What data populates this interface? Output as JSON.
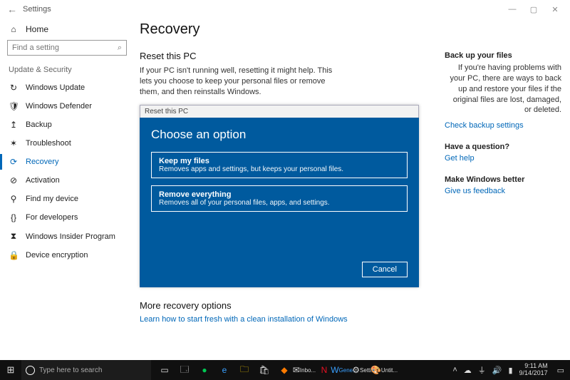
{
  "titlebar": {
    "title": "Settings"
  },
  "sidebar": {
    "home": "Home",
    "search_placeholder": "Find a setting",
    "group": "Update & Security",
    "items": [
      {
        "label": "Windows Update",
        "icon": "↻"
      },
      {
        "label": "Windows Defender",
        "icon": "🛡"
      },
      {
        "label": "Backup",
        "icon": "↥"
      },
      {
        "label": "Troubleshoot",
        "icon": "✶"
      },
      {
        "label": "Recovery",
        "icon": "⟳",
        "active": true
      },
      {
        "label": "Activation",
        "icon": "⊘"
      },
      {
        "label": "Find my device",
        "icon": "⚲"
      },
      {
        "label": "For developers",
        "icon": "{}"
      },
      {
        "label": "Windows Insider Program",
        "icon": "⧗"
      },
      {
        "label": "Device encryption",
        "icon": "🔒"
      }
    ]
  },
  "content": {
    "heading": "Recovery",
    "reset_heading": "Reset this PC",
    "reset_desc": "If your PC isn't running well, resetting it might help. This lets you choose to keep your personal files or remove them, and then reinstalls Windows.",
    "more_heading": "More recovery options",
    "more_link": "Learn how to start fresh with a clean installation of Windows"
  },
  "dialog": {
    "header": "Reset this PC",
    "title": "Choose an option",
    "options": [
      {
        "title": "Keep my files",
        "sub": "Removes apps and settings, but keeps your personal files."
      },
      {
        "title": "Remove everything",
        "sub": "Removes all of your personal files, apps, and settings."
      }
    ],
    "cancel": "Cancel"
  },
  "rightpane": {
    "backup_h": "Back up your files",
    "backup_p": "If you're having problems with your PC, there are ways to back up and restore your files if the original files are lost, damaged, or deleted.",
    "backup_link": "Check backup settings",
    "question_h": "Have a question?",
    "question_link": "Get help",
    "better_h": "Make Windows better",
    "better_link": "Give us feedback"
  },
  "taskbar": {
    "search_placeholder": "Type here to search",
    "labels": [
      "Inbo...",
      "",
      "Gene...",
      "Setti...",
      "Untit..."
    ],
    "clock_time": "9:11 AM",
    "clock_date": "9/14/2017"
  }
}
